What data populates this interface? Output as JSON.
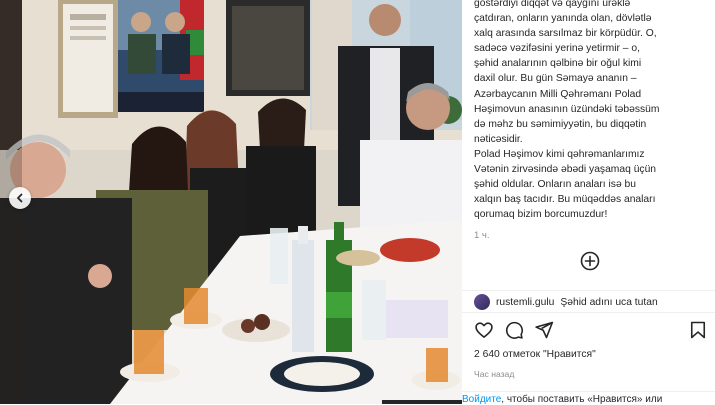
{
  "caption": {
    "lines": [
      "göstərdiyi diqqət və qayğını ürəklə",
      "çatdıran, onların yanında olan, dövlətlə",
      "xalq arasında sarsılmaz bir körpüdür. O,",
      "sadəcə vəzifəsini yerinə yetirmir – o,",
      "şəhid analarının qəlbinə bir oğul kimi",
      "daxil olur. Bu gün Səmayə ananın –",
      "Azərbaycanın Milli Qəhrəmanı Polad",
      "Həşimovun anasının üzündəki təbəssüm",
      "də məhz bu səmimiyyətin, bu diqqətin",
      "nəticəsidir.",
      "Polad Həşimov kimi qəhrəmanlarımız",
      "Vətənin zirvəsində əbədi yaşamaq üçün",
      "şəhid oldular. Onların anaları isə bu",
      "xalqın baş tacıdır. Bu müqəddəs anaları",
      "qorumaq bizim borcumuzdur!"
    ],
    "time": "1 ч."
  },
  "comment": {
    "user": "rustemli.gulu",
    "text": "Şəhid adını uca tutan"
  },
  "likes": "2 640 отметок \"Нравится\"",
  "posted_ago": "Час назад",
  "login": {
    "link": "Войдите",
    "text": ", чтобы поставить «Нравится» или"
  },
  "icons": {
    "like": "heart-icon",
    "comment": "comment-icon",
    "share": "share-icon",
    "save": "bookmark-icon",
    "more": "plus-circle-icon",
    "prev": "chevron-left-icon"
  },
  "colors": {
    "link": "#0095f6",
    "muted": "#8e8e8e",
    "text": "#262626"
  }
}
